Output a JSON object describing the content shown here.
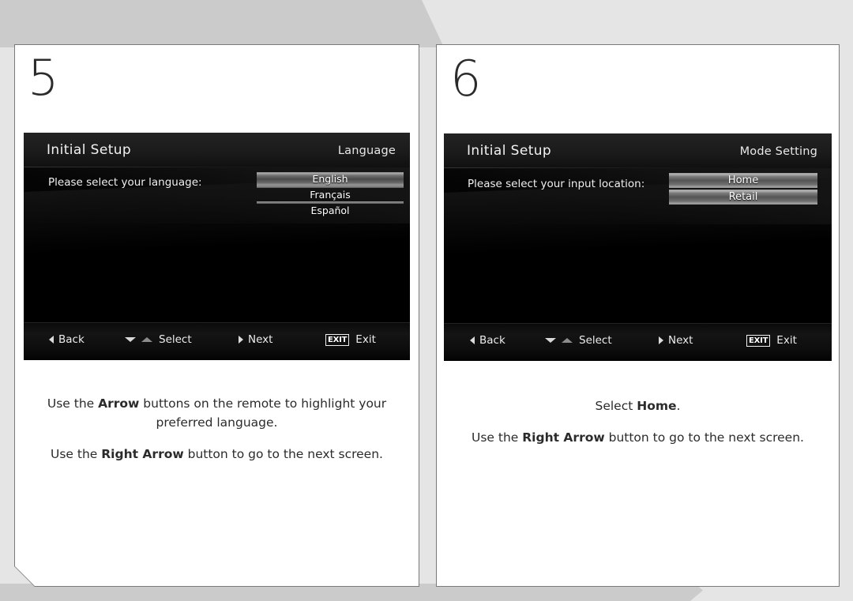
{
  "background": {
    "base_color": "#e5e5e5",
    "accent_color": "#cbcbcb"
  },
  "panels": [
    {
      "step_number": "5",
      "screen": {
        "title": "Initial Setup",
        "subtitle": "Language",
        "prompt": "Please select your language:",
        "options": [
          {
            "label": "English",
            "selected": true
          },
          {
            "label": "Français",
            "selected": false
          },
          {
            "label": "Español",
            "selected": false
          }
        ],
        "nav": {
          "back": "Back",
          "select": "Select",
          "next": "Next",
          "exit_key": "EXIT",
          "exit": "Exit"
        }
      },
      "caption": {
        "line1_a": "Use the ",
        "line1_b": "Arrow",
        "line1_c": " buttons on the remote to highlight your preferred language.",
        "line2_a": "Use the ",
        "line2_b": "Right Arrow",
        "line2_c": " button to go to the next screen."
      }
    },
    {
      "step_number": "6",
      "screen": {
        "title": "Initial Setup",
        "subtitle": "Mode Setting",
        "prompt": "Please select your input location:",
        "options": [
          {
            "label": "Home",
            "selected": true
          },
          {
            "label": "Retail",
            "selected": true
          }
        ],
        "nav": {
          "back": "Back",
          "select": "Select",
          "next": "Next",
          "exit_key": "EXIT",
          "exit": "Exit"
        }
      },
      "caption": {
        "line1_a": "Select ",
        "line1_b": "Home",
        "line1_c": ".",
        "line2_a": "Use the ",
        "line2_b": "Right Arrow",
        "line2_c": " button to go to the next screen."
      }
    }
  ]
}
